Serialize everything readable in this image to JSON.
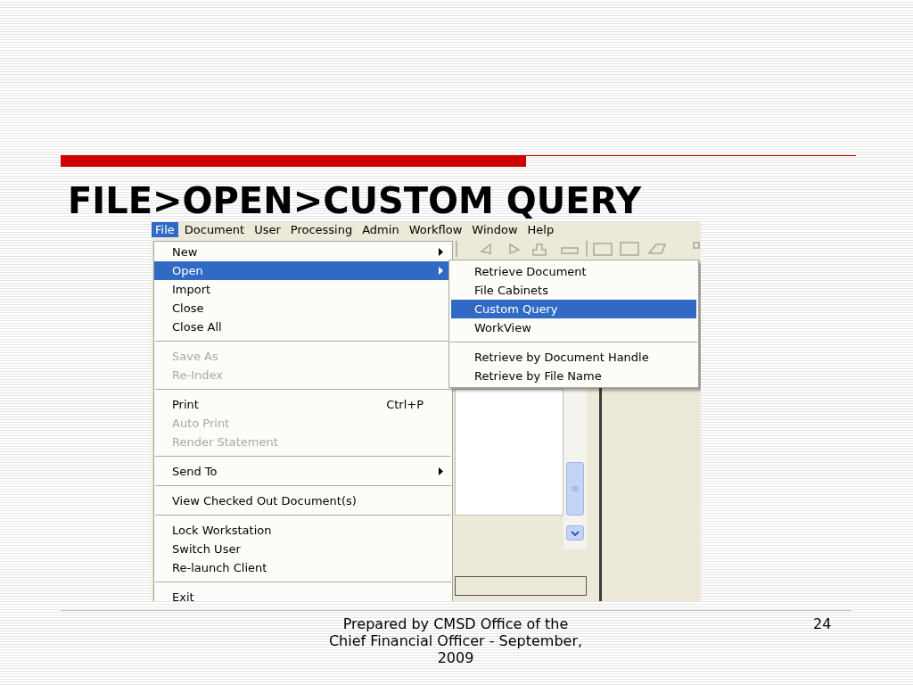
{
  "slide": {
    "title": "FILE>OPEN>CUSTOM QUERY",
    "footer": "Prepared by CMSD Office of the Chief Financial Officer - September, 2009",
    "page_number": "24"
  },
  "menu_bar": [
    {
      "label": "File",
      "selected": true
    },
    {
      "label": "Document",
      "selected": false
    },
    {
      "label": "User",
      "selected": false
    },
    {
      "label": "Processing",
      "selected": false
    },
    {
      "label": "Admin",
      "selected": false
    },
    {
      "label": "Workflow",
      "selected": false
    },
    {
      "label": "Window",
      "selected": false
    },
    {
      "label": "Help",
      "selected": false
    }
  ],
  "file_menu": [
    {
      "kind": "item",
      "label": "New",
      "disabled": false,
      "selected": false,
      "submenu": true
    },
    {
      "kind": "item",
      "label": "Open",
      "disabled": false,
      "selected": true,
      "submenu": true
    },
    {
      "kind": "item",
      "label": "Import",
      "disabled": false,
      "selected": false,
      "submenu": false
    },
    {
      "kind": "item",
      "label": "Close",
      "disabled": false,
      "selected": false,
      "submenu": false
    },
    {
      "kind": "item",
      "label": "Close All",
      "disabled": false,
      "selected": false,
      "submenu": false
    },
    {
      "kind": "separator"
    },
    {
      "kind": "item",
      "label": "Save As",
      "disabled": true,
      "selected": false,
      "submenu": false
    },
    {
      "kind": "item",
      "label": "Re-Index",
      "disabled": true,
      "selected": false,
      "submenu": false
    },
    {
      "kind": "separator"
    },
    {
      "kind": "item",
      "label": "Print",
      "shortcut": "Ctrl+P",
      "disabled": false,
      "selected": false,
      "submenu": false
    },
    {
      "kind": "item",
      "label": "Auto Print",
      "disabled": true,
      "selected": false,
      "submenu": false
    },
    {
      "kind": "item",
      "label": "Render Statement",
      "disabled": true,
      "selected": false,
      "submenu": false
    },
    {
      "kind": "separator"
    },
    {
      "kind": "item",
      "label": "Send To",
      "disabled": false,
      "selected": false,
      "submenu": true
    },
    {
      "kind": "separator"
    },
    {
      "kind": "item",
      "label": "View Checked Out Document(s)",
      "disabled": false,
      "selected": false,
      "submenu": false
    },
    {
      "kind": "separator"
    },
    {
      "kind": "item",
      "label": "Lock Workstation",
      "disabled": false,
      "selected": false,
      "submenu": false
    },
    {
      "kind": "item",
      "label": "Switch User",
      "disabled": false,
      "selected": false,
      "submenu": false
    },
    {
      "kind": "item",
      "label": "Re-launch Client",
      "disabled": false,
      "selected": false,
      "submenu": false
    },
    {
      "kind": "separator"
    },
    {
      "kind": "item",
      "label": "Exit",
      "disabled": false,
      "selected": false,
      "submenu": false
    }
  ],
  "open_submenu": [
    {
      "kind": "item",
      "label": "Retrieve Document",
      "selected": false
    },
    {
      "kind": "item",
      "label": "File Cabinets",
      "selected": false
    },
    {
      "kind": "item",
      "label": "Custom Query",
      "selected": true
    },
    {
      "kind": "item",
      "label": "WorkView",
      "selected": false
    },
    {
      "kind": "separator"
    },
    {
      "kind": "item",
      "label": "Retrieve by Document Handle",
      "selected": false
    },
    {
      "kind": "item",
      "label": "Retrieve by File Name",
      "selected": false
    }
  ]
}
